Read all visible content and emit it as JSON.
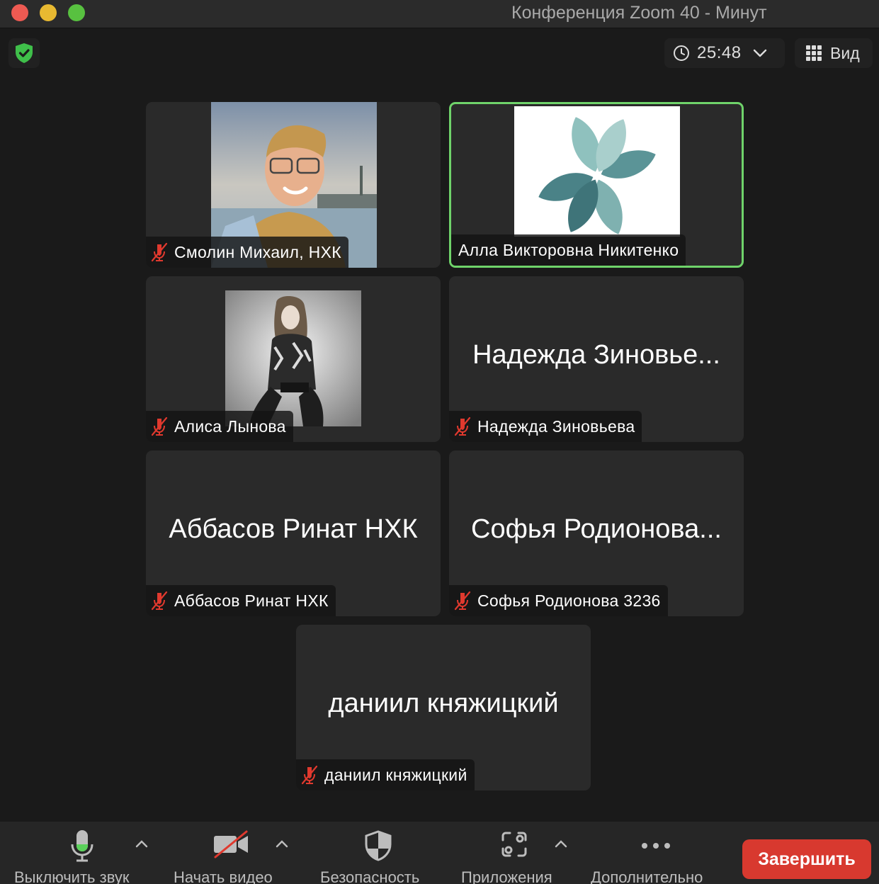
{
  "window": {
    "title": "Конференция Zoom   40 - Минут"
  },
  "topbar": {
    "timer": "25:48",
    "view_label": "Вид"
  },
  "tiles": [
    {
      "big_name": "",
      "name": "Смолин Михаил, НХК",
      "muted": true,
      "active": false
    },
    {
      "big_name": "",
      "name": "Алла Викторовна Никитенко",
      "muted": false,
      "active": true
    },
    {
      "big_name": "",
      "name": "Алиса Лынова",
      "muted": true,
      "active": false
    },
    {
      "big_name": "Надежда Зиновье...",
      "name": "Надежда Зиновьева",
      "muted": true,
      "active": false
    },
    {
      "big_name": "Аббасов Ринат НХК",
      "name": "Аббасов Ринат НХК",
      "muted": true,
      "active": false
    },
    {
      "big_name": "Софья Родионова...",
      "name": "Софья Родионова 3236",
      "muted": true,
      "active": false
    },
    {
      "big_name": "даниил княжицкий",
      "name": "даниил княжицкий",
      "muted": true,
      "active": false
    }
  ],
  "toolbar": {
    "mute_label": "Выключить звук",
    "video_label": "Начать видео",
    "security_label": "Безопасность",
    "apps_label": "Приложения",
    "more_label": "Дополнительно",
    "end_label": "Завершить"
  },
  "colors": {
    "active_speaker_border": "#6fd36a",
    "end_button": "#d8392f",
    "muted_icon": "#e0392e",
    "mic_level": "#5bd15b"
  }
}
